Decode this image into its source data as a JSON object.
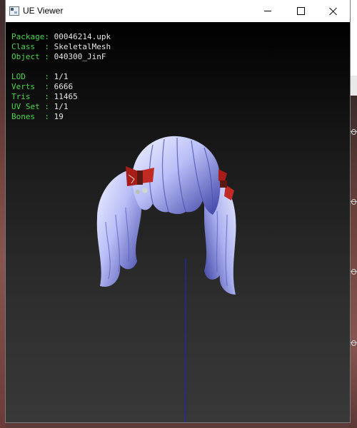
{
  "window": {
    "title": "UE Viewer",
    "icon": "app-icon"
  },
  "info": {
    "package": {
      "label": "Package:",
      "value": "00046214.upk"
    },
    "class": {
      "label": "Class  :",
      "value": "SkeletalMesh"
    },
    "object": {
      "label": "Object :",
      "value": "040300_JinF"
    },
    "lod": {
      "label": "LOD    :",
      "value": "1/1"
    },
    "verts": {
      "label": "Verts  :",
      "value": "6666"
    },
    "tris": {
      "label": "Tris   :",
      "value": "11465"
    },
    "uvset": {
      "label": "UV Set :",
      "value": "1/1"
    },
    "bones": {
      "label": "Bones  :",
      "value": "19"
    }
  },
  "colors": {
    "label_green": "#49d649",
    "value_white": "#e6e6e6",
    "axis_blue": "#1e2aa8",
    "hair": "#cfd3ff",
    "bow_red": "#b3201c"
  }
}
